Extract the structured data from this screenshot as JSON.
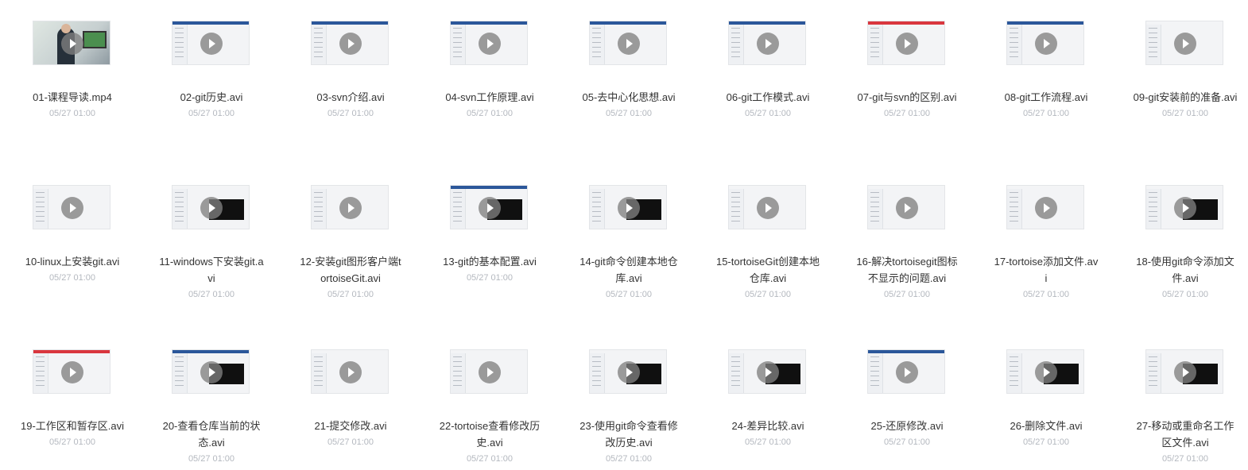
{
  "files": [
    {
      "name": "01-课程导读.mp4",
      "time": "05/27 01:00",
      "thumb": "video"
    },
    {
      "name": "02-git历史.avi",
      "time": "05/27 01:00",
      "thumb": "doc"
    },
    {
      "name": "03-svn介绍.avi",
      "time": "05/27 01:00",
      "thumb": "doc"
    },
    {
      "name": "04-svn工作原理.avi",
      "time": "05/27 01:00",
      "thumb": "doc"
    },
    {
      "name": "05-去中心化思想.avi",
      "time": "05/27 01:00",
      "thumb": "doc"
    },
    {
      "name": "06-git工作模式.avi",
      "time": "05/27 01:00",
      "thumb": "doc"
    },
    {
      "name": "07-git与svn的区别.avi",
      "time": "05/27 01:00",
      "thumb": "doc-red"
    },
    {
      "name": "08-git工作流程.avi",
      "time": "05/27 01:00",
      "thumb": "doc"
    },
    {
      "name": "09-git安装前的准备.avi",
      "time": "05/27 01:00",
      "thumb": "explorer"
    },
    {
      "name": "10-linux上安装git.avi",
      "time": "05/27 01:00",
      "thumb": "explorer"
    },
    {
      "name": "11-windows下安装git.avi",
      "time": "05/27 01:00",
      "thumb": "explorer-term"
    },
    {
      "name": "12-安装git图形客户端tortoiseGit.avi",
      "time": "05/27 01:00",
      "thumb": "explorer"
    },
    {
      "name": "13-git的基本配置.avi",
      "time": "05/27 01:00",
      "thumb": "doc-term"
    },
    {
      "name": "14-git命令创建本地仓库.avi",
      "time": "05/27 01:00",
      "thumb": "explorer-term"
    },
    {
      "name": "15-tortoiseGit创建本地仓库.avi",
      "time": "05/27 01:00",
      "thumb": "explorer"
    },
    {
      "name": "16-解决tortoisegit图标不显示的问题.avi",
      "time": "05/27 01:00",
      "thumb": "explorer"
    },
    {
      "name": "17-tortoise添加文件.avi",
      "time": "05/27 01:00",
      "thumb": "explorer"
    },
    {
      "name": "18-使用git命令添加文件.avi",
      "time": "05/27 01:00",
      "thumb": "explorer-term"
    },
    {
      "name": "19-工作区和暂存区.avi",
      "time": "05/27 01:00",
      "thumb": "doc-red"
    },
    {
      "name": "20-查看仓库当前的状态.avi",
      "time": "05/27 01:00",
      "thumb": "doc-term"
    },
    {
      "name": "21-提交修改.avi",
      "time": "05/27 01:00",
      "thumb": "explorer"
    },
    {
      "name": "22-tortoise查看修改历史.avi",
      "time": "05/27 01:00",
      "thumb": "explorer"
    },
    {
      "name": "23-使用git命令查看修改历史.avi",
      "time": "05/27 01:00",
      "thumb": "explorer-term"
    },
    {
      "name": "24-差异比较.avi",
      "time": "05/27 01:00",
      "thumb": "explorer-term"
    },
    {
      "name": "25-还原修改.avi",
      "time": "05/27 01:00",
      "thumb": "doc"
    },
    {
      "name": "26-删除文件.avi",
      "time": "05/27 01:00",
      "thumb": "explorer-term"
    },
    {
      "name": "27-移动或重命名工作区文件.avi",
      "time": "05/27 01:00",
      "thumb": "explorer-term"
    }
  ],
  "icons": {
    "play": "play-icon"
  }
}
